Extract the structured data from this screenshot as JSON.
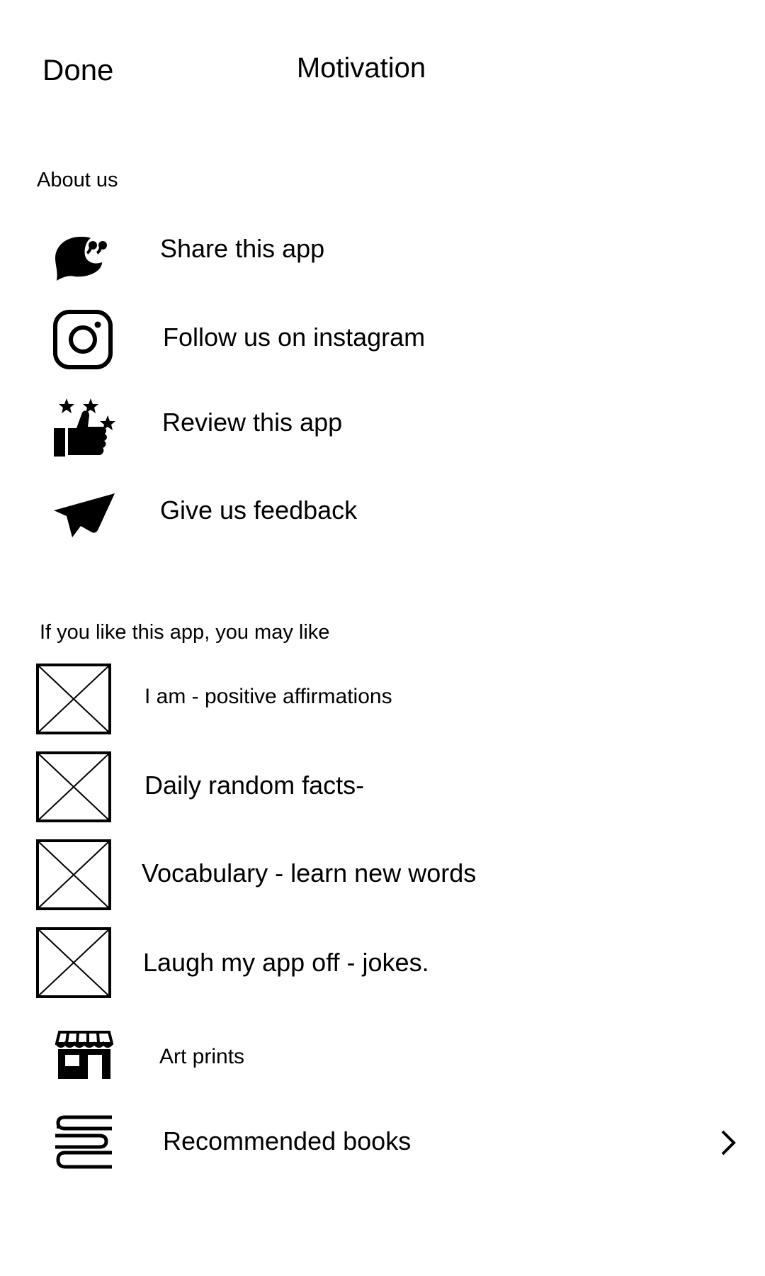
{
  "header": {
    "done_label": "Done",
    "title": "Motivation"
  },
  "about": {
    "heading": "About us",
    "items": [
      {
        "label": "Share this app",
        "icon": "speech-bubble-icon"
      },
      {
        "label": "Follow us on instagram",
        "icon": "instagram-icon"
      },
      {
        "label": "Review this app",
        "icon": "thumbs-up-stars-icon"
      },
      {
        "label": "Give us feedback",
        "icon": "paper-plane-icon"
      }
    ]
  },
  "recommendations": {
    "heading": "If you like this app, you may like",
    "apps": [
      {
        "label": "I am - positive affirmations",
        "icon": "image-placeholder-icon"
      },
      {
        "label": "Daily random facts-",
        "icon": "image-placeholder-icon"
      },
      {
        "label": "Vocabulary - learn new words",
        "icon": "image-placeholder-icon"
      },
      {
        "label": "Laugh my app off - jokes.",
        "icon": "image-placeholder-icon"
      }
    ],
    "art_prints": {
      "label": "Art prints",
      "icon": "storefront-icon"
    },
    "books": {
      "label": "Recommended books",
      "icon": "books-icon",
      "chevron_icon": "chevron-right-icon"
    }
  }
}
